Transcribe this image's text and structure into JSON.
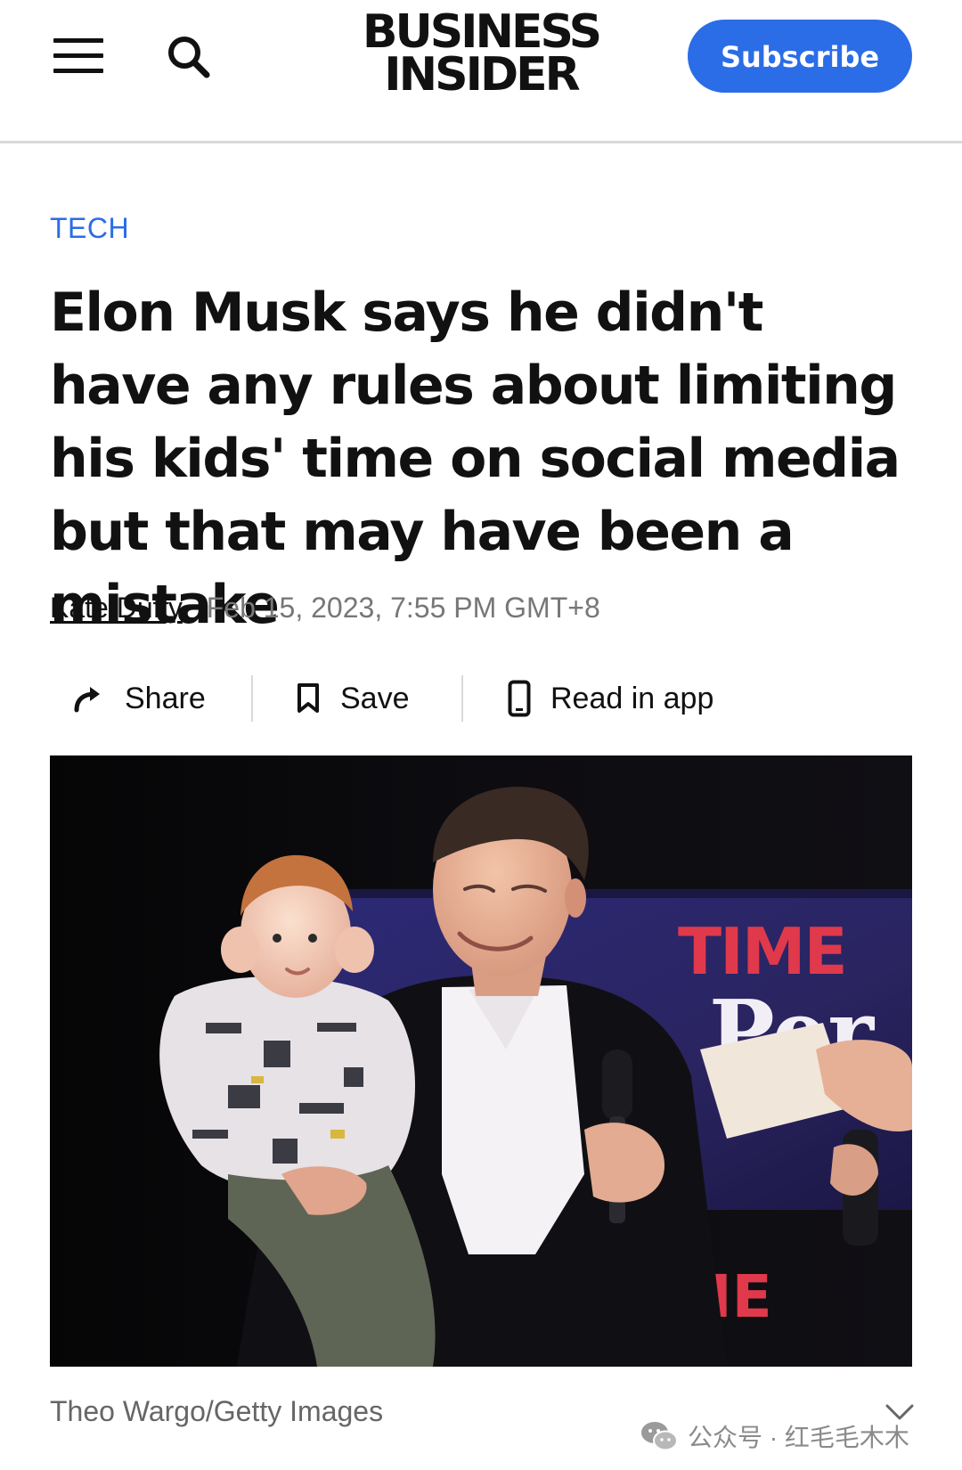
{
  "header": {
    "logo_line1": "BUSINESS",
    "logo_line2": "INSIDER",
    "subscribe_label": "Subscribe",
    "brand_color": "#2b6de6"
  },
  "article": {
    "category": "TECH",
    "headline": "Elon Musk says he didn't have any rules about limiting his kids' time on social media but that may have been a mistake",
    "author": "Kate Duffy",
    "date": "Feb 15, 2023, 7:55 PM GMT+8"
  },
  "actions": {
    "share_label": "Share",
    "save_label": "Save",
    "app_label": "Read in app"
  },
  "photo": {
    "backdrop_text_1": "TIME",
    "backdrop_text_2": "Per",
    "backdrop_text_3": "ME",
    "caption": "Theo Wargo/Getty Images"
  },
  "watermark": {
    "text": "公众号 · 红毛毛木木"
  },
  "icons": {
    "menu": "hamburger-menu-icon",
    "search": "search-icon",
    "share": "share-arrow-icon",
    "save": "bookmark-icon",
    "app": "phone-icon",
    "watermark": "wechat-icon",
    "more": "chevron-down-icon"
  }
}
